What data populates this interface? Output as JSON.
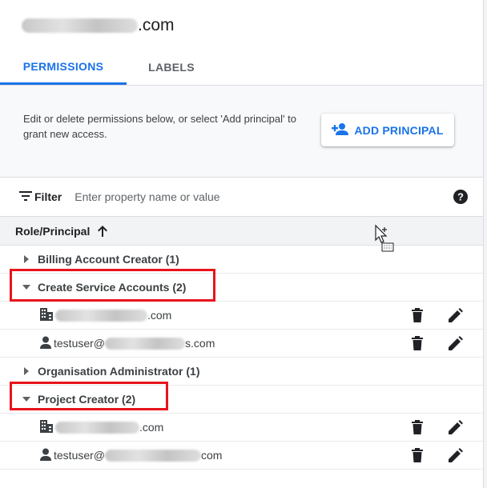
{
  "header": {
    "title_suffix": ".com"
  },
  "tabs": [
    {
      "label": "PERMISSIONS",
      "active": true
    },
    {
      "label": "LABELS",
      "active": false
    }
  ],
  "info": {
    "text": "Edit or delete permissions below, or select 'Add principal' to grant new access.",
    "add_button": "ADD PRINCIPAL"
  },
  "filter": {
    "label": "Filter",
    "placeholder": "Enter property name or value"
  },
  "table": {
    "column_header": "Role/Principal",
    "rows": [
      {
        "type": "role",
        "label": "Billing Account Creator (1)",
        "expanded": false
      },
      {
        "type": "role",
        "label": "Create Service Accounts (2)",
        "expanded": true
      },
      {
        "type": "member",
        "kind": "domain",
        "suffix": ".com"
      },
      {
        "type": "member",
        "kind": "user",
        "prefix": "testuser@",
        "suffix": "s.com"
      },
      {
        "type": "role",
        "label": "Organisation Administrator (1)",
        "expanded": false
      },
      {
        "type": "role",
        "label": "Project Creator (2)",
        "expanded": true
      },
      {
        "type": "member",
        "kind": "domain",
        "suffix": ".com"
      },
      {
        "type": "member",
        "kind": "user",
        "prefix": "testuser@",
        "suffix": "com"
      }
    ]
  },
  "colors": {
    "accent": "#1a73e8",
    "highlight": "#e8141b"
  }
}
